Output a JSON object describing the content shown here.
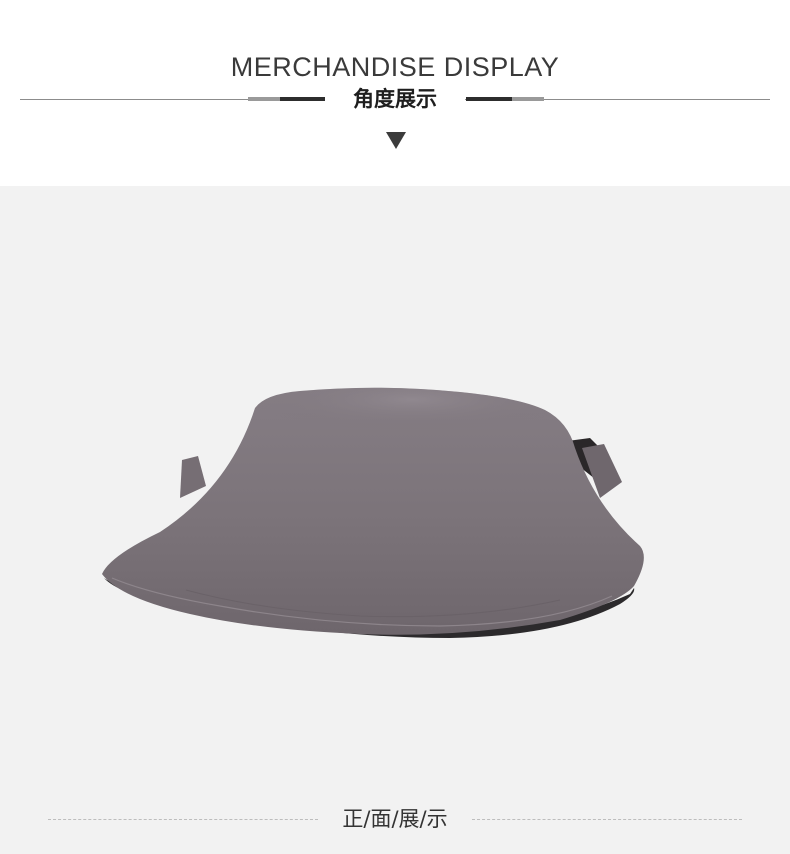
{
  "header": {
    "title": "MERCHANDISE DISPLAY",
    "subtitle": "角度展示",
    "arrow_icon": "triangle-down-icon"
  },
  "product": {
    "image_subject": "visor hat",
    "color": "#7a7279",
    "background_color": "#f2f2f2"
  },
  "footer": {
    "label": "正/面/展/示"
  }
}
